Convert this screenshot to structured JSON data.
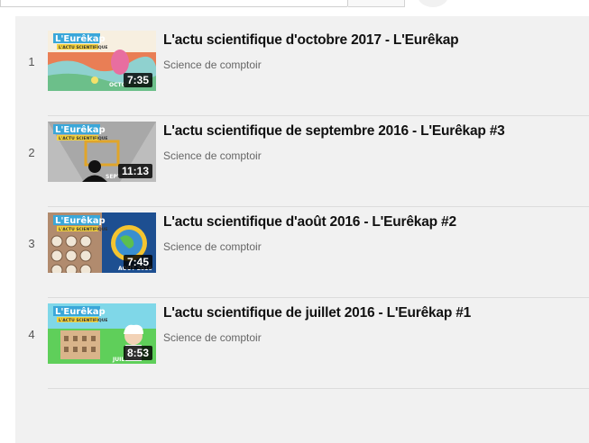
{
  "playlist": {
    "items": [
      {
        "index": "1",
        "title": "L'actu scientifique d'octobre 2017 - L'Eurêkap",
        "channel": "Science de comptoir",
        "duration": "7:35",
        "thumb_bg": "#ec7a4a"
      },
      {
        "index": "2",
        "title": "L'actu scientifique de septembre 2016 - L'Eurêkap #3",
        "channel": "Science de comptoir",
        "duration": "11:13",
        "thumb_bg": "#9a9a9a"
      },
      {
        "index": "3",
        "title": "L'actu scientifique d'août 2016 - L'Eurêkap #2",
        "channel": "Science de comptoir",
        "duration": "7:45",
        "thumb_bg": "#1e4f8c"
      },
      {
        "index": "4",
        "title": "L'actu scientifique de juillet 2016 - L'Eurêkap #1",
        "channel": "Science de comptoir",
        "duration": "8:53",
        "thumb_bg": "#5fcf5a"
      }
    ]
  }
}
